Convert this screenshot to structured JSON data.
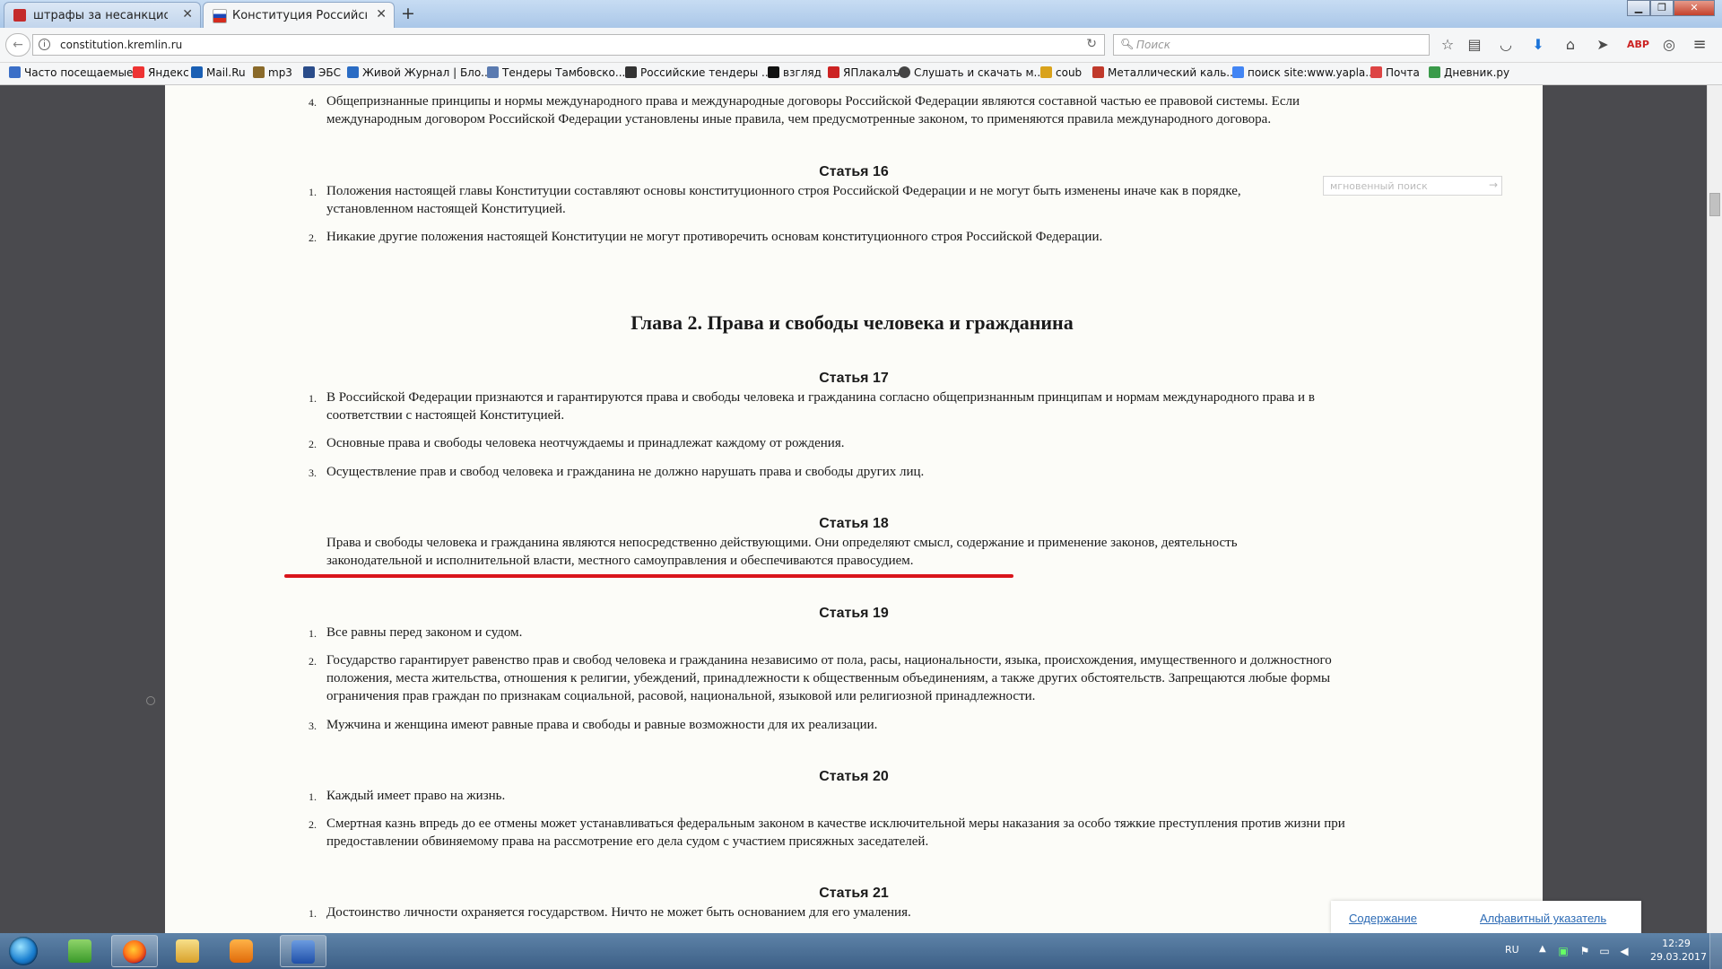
{
  "browser": {
    "tabs": [
      {
        "title": "штрафы за несанкциони...",
        "active": false
      },
      {
        "title": "Конституция Российской ...",
        "active": true
      }
    ],
    "url": "constitution.kremlin.ru",
    "search_placeholder": "Поиск",
    "bookmarks": [
      "Часто посещаемые",
      "Яндекс",
      "Mail.Ru",
      "mp3",
      "ЭБС",
      "Живой Журнал | Бло...",
      "Тендеры Тамбовско...",
      "Российские тендеры ...",
      "взгляд",
      "ЯПлакалъ",
      "Слушать и скачать м...",
      "coub",
      "Металлический каль...",
      "поиск site:www.yapla...",
      "Почта",
      "Дневник.ру"
    ]
  },
  "document": {
    "instant_search_placeholder": "мгновенный поиск",
    "art15_item4_num": "4.",
    "art15_item4": "Общепризнанные принципы и нормы международного права и международные договоры Российской Федерации являются составной частью ее правовой системы. Если международным договором Российской Федерации установлены иные правила, чем предусмотренные законом, то применяются правила международного договора.",
    "art16_title": "Статья 16",
    "art16_item1": "Положения настоящей главы Конституции составляют основы конституционного строя Российской Федерации и не могут быть изменены иначе как в порядке, установленном настоящей Конституцией.",
    "art16_item2": "Никакие другие положения настоящей Конституции не могут противоречить основам конституционного строя Российской Федерации.",
    "chapter_title": "Глава 2. Права и свободы человека и гражданина",
    "art17_title": "Статья 17",
    "art17_item1": "В Российской Федерации признаются и гарантируются права и свободы человека и гражданина согласно общепризнанным принципам и нормам международного права и в соответствии с настоящей Конституцией.",
    "art17_item2": "Основные права и свободы человека неотчуждаемы и принадлежат каждому от рождения.",
    "art17_item3": "Осуществление прав и свобод человека и гражданина не должно нарушать права и свободы других лиц.",
    "art18_title": "Статья 18",
    "art18_text": "Права и свободы человека и гражданина являются непосредственно действующими. Они определяют смысл, содержание и применение законов, деятельность законодательной и исполнительной власти, местного самоуправления и обеспечиваются правосудием.",
    "art19_title": "Статья 19",
    "art19_item1": "Все равны перед законом и судом.",
    "art19_item2": "Государство гарантирует равенство прав и свобод человека и гражданина независимо от пола, расы, национальности, языка, происхождения, имущественного и должностного положения, места жительства, отношения к религии, убеждений, принадлежности к общественным объединениям, а также других обстоятельств. Запрещаются любые формы ограничения прав граждан по признакам социальной, расовой, национальной, языковой или религиозной принадлежности.",
    "art19_item3": "Мужчина и женщина имеют равные права и свободы и равные возможности для их реализации.",
    "art20_title": "Статья 20",
    "art20_item1": "Каждый имеет право на жизнь.",
    "art20_item2": "Смертная казнь впредь до ее отмены может устанавливаться федеральным законом в качестве исключительной меры наказания за особо тяжкие преступления против жизни при предоставлении обвиняемому права на рассмотрение его дела судом с участием присяжных заседателей.",
    "art21_title": "Статья 21",
    "art21_item1": "Достоинство личности охраняется государством. Ничто не может быть основанием для его умаления.",
    "n1": "1.",
    "n2": "2.",
    "n3": "3.",
    "footer_contents": "Содержание",
    "footer_index": "Алфавитный указатель"
  },
  "taskbar": {
    "lang": "RU",
    "time": "12:29",
    "date": "29.03.2017"
  },
  "colors": {
    "highlight_underline": "#d9151b",
    "link": "#2d6bb5"
  }
}
